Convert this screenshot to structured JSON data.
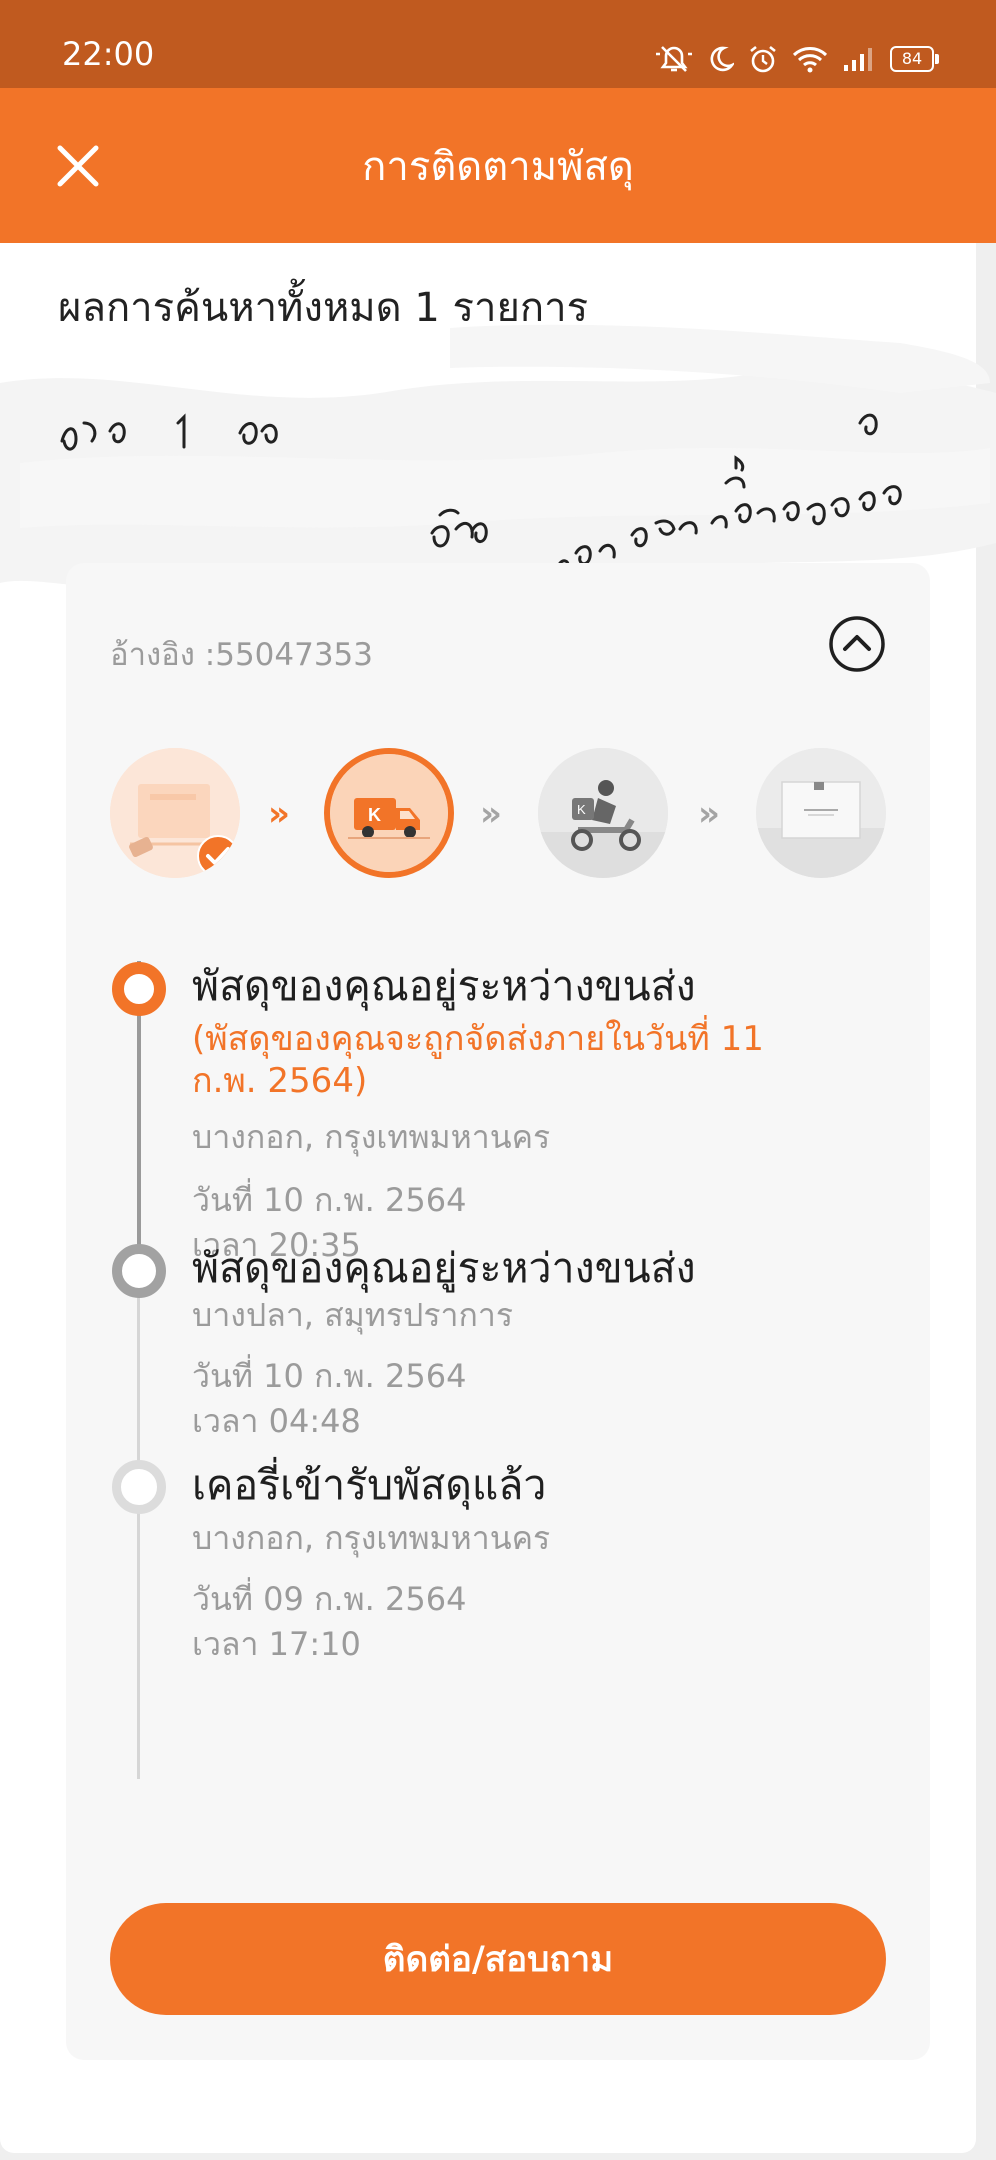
{
  "status_bar": {
    "time": "22:00",
    "battery": "84",
    "icons": [
      "mute-icon",
      "moon-icon",
      "alarm-icon",
      "wifi-icon",
      "signal-icon",
      "battery-icon"
    ]
  },
  "app_bar": {
    "title": "การติดตามพัสดุ",
    "close_icon": "close-icon"
  },
  "results": {
    "count_text": "ผลการค้นหาทั้งหมด 1 รายการ"
  },
  "parcel": {
    "reference": "อ้างอิง :55047353",
    "collapse_icon": "chevron-up-icon",
    "steps": [
      {
        "name": "picked-up",
        "icon": "box-icon",
        "state": "done"
      },
      {
        "name": "in-transit",
        "icon": "truck-icon",
        "state": "current"
      },
      {
        "name": "out-for-delivery",
        "icon": "scooter-icon",
        "state": "pending"
      },
      {
        "name": "delivered",
        "icon": "package-icon",
        "state": "pending"
      }
    ],
    "events": [
      {
        "title": "พัสดุของคุณอยู่ระหว่างขนส่ง",
        "note": "(พัสดุของคุณจะถูกจัดส่งภายในวันที่ 11 ก.พ. 2564)",
        "location": "บางกอก, กรุงเทพมหานคร",
        "date": "วันที่ 10 ก.พ. 2564",
        "time": "เวลา 20:35"
      },
      {
        "title": "พัสดุของคุณอยู่ระหว่างขนส่ง",
        "location": "บางปลา, สมุทรปราการ",
        "date": "วันที่ 10 ก.พ. 2564",
        "time": "เวลา 04:48"
      },
      {
        "title": "เคอรี่เข้ารับพัสดุแล้ว",
        "location": "บางกอก, กรุงเทพมหานคร",
        "date": "วันที่ 09 ก.พ. 2564",
        "time": "เวลา 17:10"
      }
    ],
    "contact_button": "ติดต่อ/สอบถาม"
  },
  "colors": {
    "accent": "#f27428",
    "status_bar": "#c05a1f",
    "muted_text": "#9b9b9b"
  }
}
